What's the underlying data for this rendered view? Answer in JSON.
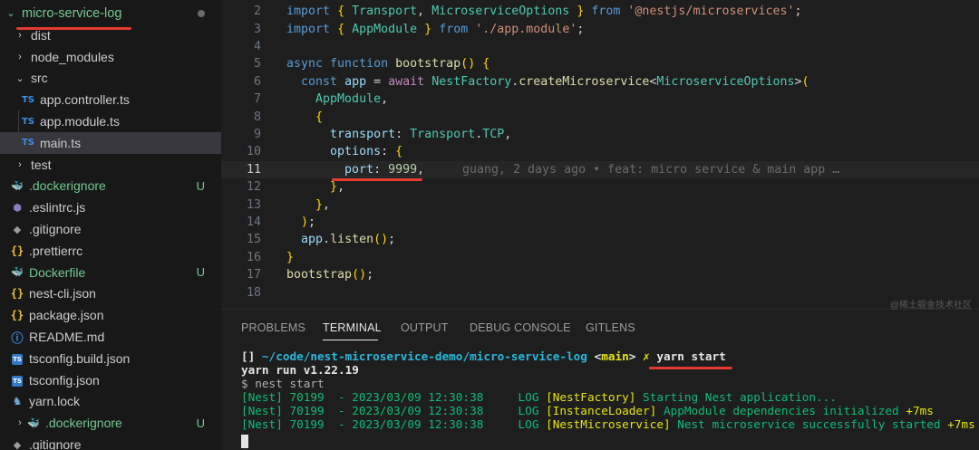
{
  "explorer": {
    "root": "micro-service-log",
    "items": [
      {
        "label": "dist",
        "chev": "›",
        "icon": "",
        "status": ""
      },
      {
        "label": "node_modules",
        "chev": "›",
        "icon": "",
        "status": ""
      },
      {
        "label": "src",
        "chev": "⌄",
        "icon": "",
        "status": ""
      },
      {
        "label": "app.controller.ts",
        "chev": "",
        "icon": "TS",
        "status": ""
      },
      {
        "label": "app.module.ts",
        "chev": "",
        "icon": "TS",
        "status": ""
      },
      {
        "label": "main.ts",
        "chev": "",
        "icon": "TS",
        "status": ""
      },
      {
        "label": "test",
        "chev": "›",
        "icon": "",
        "status": ""
      },
      {
        "label": ".dockerignore",
        "chev": "",
        "icon": "docker",
        "status": "U"
      },
      {
        "label": ".eslintrc.js",
        "chev": "",
        "icon": "eslint",
        "status": ""
      },
      {
        "label": ".gitignore",
        "chev": "",
        "icon": "git",
        "status": ""
      },
      {
        "label": ".prettierrc",
        "chev": "",
        "icon": "{}",
        "status": ""
      },
      {
        "label": "Dockerfile",
        "chev": "",
        "icon": "docker",
        "status": "U"
      },
      {
        "label": "nest-cli.json",
        "chev": "",
        "icon": "{}",
        "status": ""
      },
      {
        "label": "package.json",
        "chev": "",
        "icon": "{}",
        "status": ""
      },
      {
        "label": "README.md",
        "chev": "",
        "icon": "info",
        "status": ""
      },
      {
        "label": "tsconfig.build.json",
        "chev": "",
        "icon": "tsbox",
        "status": ""
      },
      {
        "label": "tsconfig.json",
        "chev": "",
        "icon": "tsbox",
        "status": ""
      },
      {
        "label": "yarn.lock",
        "chev": "",
        "icon": "yarn",
        "status": ""
      },
      {
        "label": ".dockerignore",
        "chev": "›",
        "icon": "docker",
        "status": "U"
      },
      {
        "label": ".gitignore",
        "chev": "",
        "icon": "git",
        "status": ""
      }
    ],
    "root_status": "●"
  },
  "editor": {
    "current_line": 11,
    "lines": [
      {
        "n": "2",
        "code": "import { Transport, MicroserviceOptions } from '@nestjs/microservices';"
      },
      {
        "n": "3",
        "code": "import { AppModule } from './app.module';"
      },
      {
        "n": "4",
        "code": ""
      },
      {
        "n": "5",
        "code": "async function bootstrap() {"
      },
      {
        "n": "6",
        "code": "  const app = await NestFactory.createMicroservice<MicroserviceOptions>("
      },
      {
        "n": "7",
        "code": "    AppModule,"
      },
      {
        "n": "8",
        "code": "    {"
      },
      {
        "n": "9",
        "code": "      transport: Transport.TCP,"
      },
      {
        "n": "10",
        "code": "      options: {"
      },
      {
        "n": "11",
        "code": "        port: 9999,"
      },
      {
        "n": "12",
        "code": "      },"
      },
      {
        "n": "13",
        "code": "    },"
      },
      {
        "n": "14",
        "code": "  );"
      },
      {
        "n": "15",
        "code": "  app.listen();"
      },
      {
        "n": "16",
        "code": "}"
      },
      {
        "n": "17",
        "code": "bootstrap();"
      },
      {
        "n": "18",
        "code": ""
      }
    ],
    "blame": "guang, 2 days ago • feat: micro service & main app …"
  },
  "panel": {
    "tabs": [
      "PROBLEMS",
      "TERMINAL",
      "OUTPUT",
      "DEBUG CONSOLE",
      "GITLENS"
    ],
    "active_tab": "TERMINAL",
    "terminal": {
      "prompt_brackets": "[]",
      "prompt_path": "~/code/nest-microservice-demo/micro-service-log",
      "prompt_branch_open": "<",
      "prompt_branch": "main",
      "prompt_branch_close": ">",
      "prompt_mark": "✗",
      "command": "yarn start",
      "line2": "yarn run v1.22.19",
      "line3": "$ nest start",
      "logs": [
        {
          "prefix": "[Nest] 70199  - 2023/03/09 12:30:38     LOG ",
          "ctx": "[NestFactory]",
          "msg": " Starting Nest application...",
          "ms": ""
        },
        {
          "prefix": "[Nest] 70199  - 2023/03/09 12:30:38     LOG ",
          "ctx": "[InstanceLoader]",
          "msg": " AppModule dependencies initialized ",
          "ms": "+7ms"
        },
        {
          "prefix": "[Nest] 70199  - 2023/03/09 12:30:38     LOG ",
          "ctx": "[NestMicroservice]",
          "msg": " Nest microservice successfully started ",
          "ms": "+7ms"
        }
      ]
    }
  },
  "watermark": "@稀土掘金技术社区",
  "colors": {
    "annotation_red": "#e33a2f",
    "untracked_green": "#73c991"
  }
}
